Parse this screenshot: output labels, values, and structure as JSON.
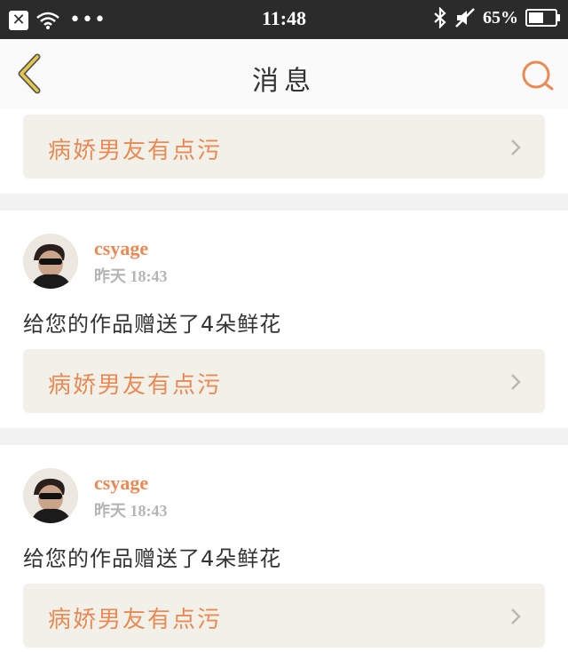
{
  "status_bar": {
    "time": "11:48",
    "battery_text": "65%",
    "battery_level": 0.65
  },
  "nav": {
    "title": "消息",
    "back_icon": "chevron-left-icon",
    "search_icon": "search-icon"
  },
  "top_card": {
    "work_title": "病娇男友有点污"
  },
  "messages": [
    {
      "username": "csyage",
      "timestamp": "昨天 18:43",
      "text": "给您的作品赠送了4朵鲜花",
      "work_title": "病娇男友有点污"
    },
    {
      "username": "csyage",
      "timestamp": "昨天 18:43",
      "text": "给您的作品赠送了4朵鲜花",
      "work_title": "病娇男友有点污"
    }
  ],
  "colors": {
    "accent": "#e98a55",
    "card_bg": "#f1f1ea",
    "status_bg": "#2b2b2b"
  }
}
